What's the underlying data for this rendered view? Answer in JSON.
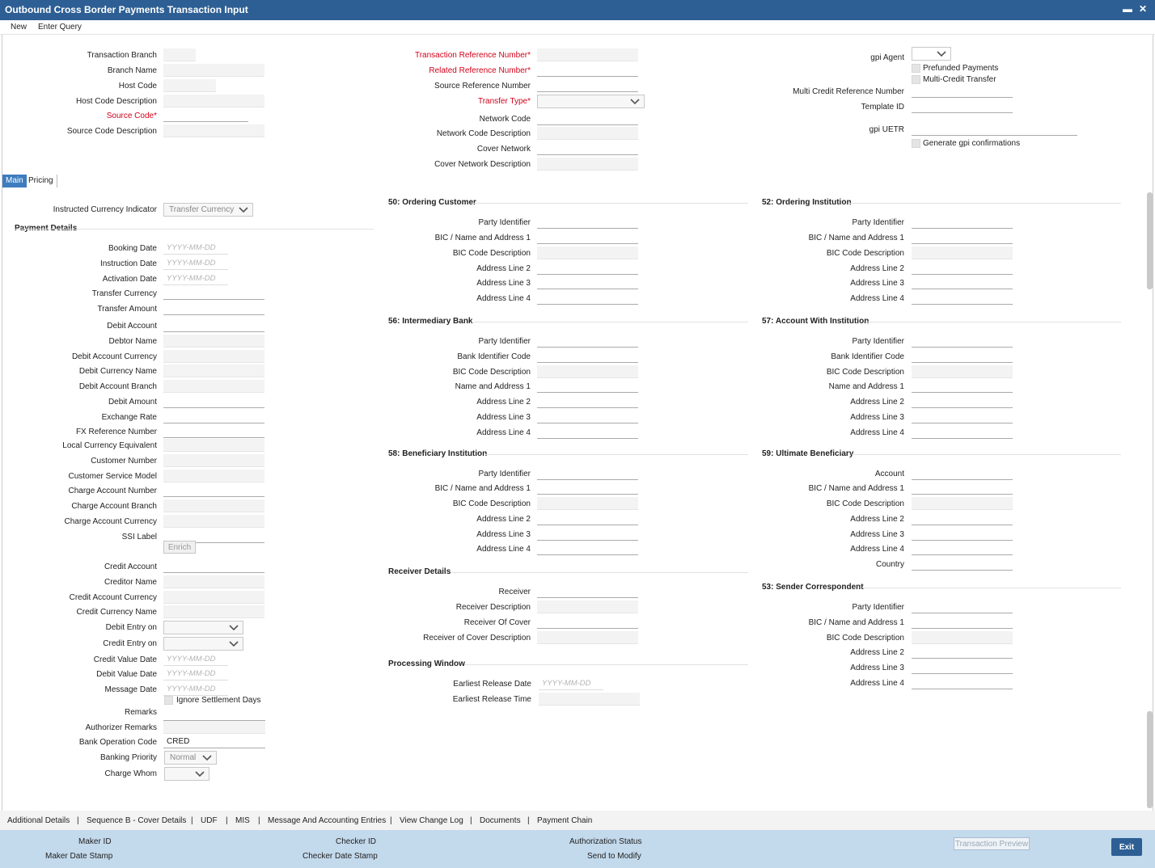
{
  "window": {
    "title": "Outbound Cross Border Payments Transaction Input",
    "minimize": "▬",
    "close": "✕"
  },
  "toolbar": {
    "new": "New",
    "enter_query": "Enter Query"
  },
  "header": {
    "col1": [
      {
        "label": "Transaction Branch",
        "type": "ro"
      },
      {
        "label": "Branch Name",
        "type": "ro"
      },
      {
        "label": "Host Code",
        "type": "ro"
      },
      {
        "label": "Host Code Description",
        "type": "ro"
      },
      {
        "label": "Source Code",
        "type": "inp",
        "required": true
      },
      {
        "label": "Source Code Description",
        "type": "ro"
      }
    ],
    "col2": [
      {
        "label": "Transaction Reference Number",
        "type": "ro",
        "required": true
      },
      {
        "label": "Related Reference Number",
        "type": "inp",
        "required": true
      },
      {
        "label": "Source Reference Number",
        "type": "inp"
      },
      {
        "label": "Transfer Type",
        "type": "sel",
        "required": true
      },
      {
        "label": "Network Code",
        "type": "inp"
      },
      {
        "label": "Network Code Description",
        "type": "ro"
      },
      {
        "label": "Cover Network",
        "type": "inp"
      },
      {
        "label": "Cover Network Description",
        "type": "ro"
      }
    ],
    "gpi_agent": "gpi Agent",
    "prefunded": "Prefunded Payments",
    "multi_credit": "Multi-Credit Transfer",
    "multi_credit_ref": "Multi Credit Reference Number",
    "template_id": "Template ID",
    "gpi_uetr": "gpi UETR",
    "generate_gpi": "Generate gpi confirmations"
  },
  "tabs": {
    "main": "Main",
    "pricing": "Pricing"
  },
  "left": {
    "instructed_currency_indicator": "Instructed Currency Indicator",
    "instructed_currency_value": "Transfer Currency",
    "payment_details": "Payment Details",
    "date_placeholder": "YYYY-MM-DD",
    "fields": [
      {
        "label": "Booking Date",
        "type": "date"
      },
      {
        "label": "Instruction Date",
        "type": "date"
      },
      {
        "label": "Activation Date",
        "type": "date"
      },
      {
        "label": "Transfer Currency",
        "type": "inp"
      },
      {
        "label": "Transfer Amount",
        "type": "inp"
      },
      {
        "label": "Debit Account",
        "type": "inp"
      },
      {
        "label": "Debtor Name",
        "type": "ro"
      },
      {
        "label": "Debit Account Currency",
        "type": "ro"
      },
      {
        "label": "Debit Currency Name",
        "type": "ro"
      },
      {
        "label": "Debit Account Branch",
        "type": "ro"
      },
      {
        "label": "Debit Amount",
        "type": "inp"
      },
      {
        "label": "Exchange Rate",
        "type": "inp"
      },
      {
        "label": "FX Reference Number",
        "type": "inp"
      },
      {
        "label": "Local Currency Equivalent",
        "type": "ro"
      },
      {
        "label": "Customer Number",
        "type": "ro"
      },
      {
        "label": "Customer Service Model",
        "type": "ro"
      },
      {
        "label": "Charge Account Number",
        "type": "inp"
      },
      {
        "label": "Charge Account Branch",
        "type": "ro"
      },
      {
        "label": "Charge Account Currency",
        "type": "ro"
      },
      {
        "label": "SSI Label",
        "type": "inp"
      }
    ],
    "enrich": "Enrich",
    "fields2": [
      {
        "label": "Credit Account",
        "type": "inp"
      },
      {
        "label": "Creditor Name",
        "type": "ro"
      },
      {
        "label": "Credit Account Currency",
        "type": "ro"
      },
      {
        "label": "Credit Currency Name",
        "type": "ro"
      },
      {
        "label": "Debit Entry on",
        "type": "sel"
      },
      {
        "label": "Credit Entry on",
        "type": "sel"
      },
      {
        "label": "Credit Value Date",
        "type": "date"
      },
      {
        "label": "Debit Value Date",
        "type": "date"
      },
      {
        "label": "Message Date",
        "type": "date"
      }
    ],
    "ignore_settlement_days": "Ignore Settlement Days",
    "remarks": "Remarks",
    "authorizer_remarks": "Authorizer Remarks",
    "bank_operation_code": "Bank Operation Code",
    "bank_operation_code_value": "CRED",
    "banking_priority": "Banking Priority",
    "banking_priority_value": "Normal",
    "charge_whom": "Charge Whom"
  },
  "sections": {
    "ordering_customer": {
      "title": "50: Ordering Customer",
      "fields": [
        {
          "label": "Party Identifier",
          "type": "inp"
        },
        {
          "label": "BIC / Name and Address 1",
          "type": "inp"
        },
        {
          "label": "BIC Code Description",
          "type": "ro"
        },
        {
          "label": "Address Line 2",
          "type": "inp"
        },
        {
          "label": "Address Line 3",
          "type": "inp"
        },
        {
          "label": "Address Line 4",
          "type": "inp"
        }
      ]
    },
    "ordering_institution": {
      "title": "52: Ordering Institution",
      "fields": [
        {
          "label": "Party Identifier",
          "type": "inp"
        },
        {
          "label": "BIC / Name and Address 1",
          "type": "inp"
        },
        {
          "label": "BIC Code Description",
          "type": "ro"
        },
        {
          "label": "Address Line 2",
          "type": "inp"
        },
        {
          "label": "Address Line 3",
          "type": "inp"
        },
        {
          "label": "Address Line 4",
          "type": "inp"
        }
      ]
    },
    "intermediary_bank": {
      "title": "56: Intermediary Bank",
      "fields": [
        {
          "label": "Party Identifier",
          "type": "inp"
        },
        {
          "label": "Bank Identifier Code",
          "type": "inp"
        },
        {
          "label": "BIC Code Description",
          "type": "ro"
        },
        {
          "label": "Name and Address 1",
          "type": "inp"
        },
        {
          "label": "Address Line 2",
          "type": "inp"
        },
        {
          "label": "Address Line 3",
          "type": "inp"
        },
        {
          "label": "Address Line 4",
          "type": "inp"
        }
      ]
    },
    "account_with_institution": {
      "title": "57: Account With Institution",
      "fields": [
        {
          "label": "Party Identifier",
          "type": "inp"
        },
        {
          "label": "Bank Identifier Code",
          "type": "inp"
        },
        {
          "label": "BIC Code Description",
          "type": "ro"
        },
        {
          "label": "Name and Address 1",
          "type": "inp"
        },
        {
          "label": "Address Line 2",
          "type": "inp"
        },
        {
          "label": "Address Line 3",
          "type": "inp"
        },
        {
          "label": "Address Line 4",
          "type": "inp"
        }
      ]
    },
    "beneficiary_institution": {
      "title": "58: Beneficiary Institution",
      "fields": [
        {
          "label": "Party Identifier",
          "type": "inp"
        },
        {
          "label": "BIC / Name and Address 1",
          "type": "inp"
        },
        {
          "label": "BIC Code Description",
          "type": "ro"
        },
        {
          "label": "Address Line 2",
          "type": "inp"
        },
        {
          "label": "Address Line 3",
          "type": "inp"
        },
        {
          "label": "Address Line 4",
          "type": "inp"
        }
      ]
    },
    "ultimate_beneficiary": {
      "title": "59: Ultimate Beneficiary",
      "fields": [
        {
          "label": "Account",
          "type": "inp"
        },
        {
          "label": "BIC / Name and Address 1",
          "type": "inp"
        },
        {
          "label": "BIC Code Description",
          "type": "ro"
        },
        {
          "label": "Address Line 2",
          "type": "inp"
        },
        {
          "label": "Address Line 3",
          "type": "inp"
        },
        {
          "label": "Address Line 4",
          "type": "inp"
        },
        {
          "label": "Country",
          "type": "inp"
        }
      ]
    },
    "receiver_details": {
      "title": "Receiver Details",
      "fields": [
        {
          "label": "Receiver",
          "type": "inp"
        },
        {
          "label": "Receiver Description",
          "type": "ro"
        },
        {
          "label": "Receiver Of Cover",
          "type": "inp"
        },
        {
          "label": "Receiver of Cover Description",
          "type": "ro"
        }
      ]
    },
    "sender_correspondent": {
      "title": "53: Sender Correspondent",
      "fields": [
        {
          "label": "Party Identifier",
          "type": "inp"
        },
        {
          "label": "BIC / Name and Address 1",
          "type": "inp"
        },
        {
          "label": "BIC Code Description",
          "type": "ro"
        },
        {
          "label": "Address Line 2",
          "type": "inp"
        },
        {
          "label": "Address Line 3",
          "type": "inp"
        },
        {
          "label": "Address Line 4",
          "type": "inp"
        }
      ]
    },
    "processing_window": {
      "title": "Processing Window",
      "fields": [
        {
          "label": "Earliest Release Date",
          "type": "date"
        },
        {
          "label": "Earliest Release Time",
          "type": "ro"
        }
      ]
    }
  },
  "bottom_links": [
    "Additional Details",
    "Sequence B - Cover Details",
    "UDF",
    "MIS",
    "Message And Accounting Entries",
    "View Change Log",
    "Documents",
    "Payment Chain"
  ],
  "footer": {
    "maker_id": "Maker ID",
    "maker_date_stamp": "Maker Date Stamp",
    "checker_id": "Checker ID",
    "checker_date_stamp": "Checker Date Stamp",
    "authorization_status": "Authorization Status",
    "send_to_modify": "Send to Modify",
    "transaction_preview": "Transaction Preview",
    "exit": "Exit"
  }
}
